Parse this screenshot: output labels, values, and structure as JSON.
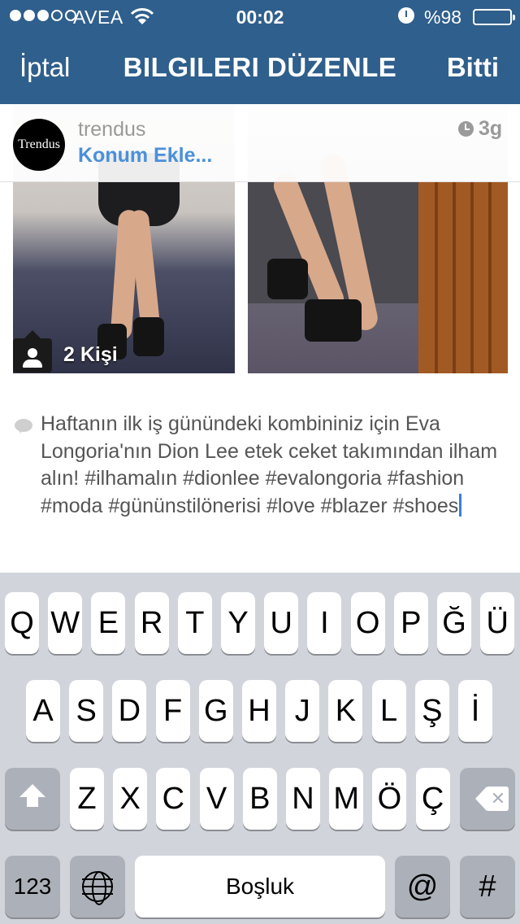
{
  "status_bar": {
    "carrier": "AVEA",
    "time": "00:02",
    "battery_percent": "%98",
    "battery_level": 0.98,
    "signal_bars_filled": 3,
    "signal_bars_total": 5
  },
  "nav": {
    "cancel_label": "İptal",
    "title": "BILGILERI DÜZENLE",
    "done_label": "Bitti"
  },
  "post": {
    "avatar_text": "Trendus",
    "username": "trendus",
    "location_label": "Konum Ekle...",
    "time_ago": "3g",
    "tagged_people": "2 Kişi",
    "caption": "Haftanın ilk iş günündeki kombininiz için Eva Longoria'nın Dion Lee etek ceket takımından ilham alın! #ilhamalın #dionlee #evalongoria #fashion #moda #gününstilönerisi #love #blazer #shoes"
  },
  "keyboard": {
    "row1": [
      "Q",
      "W",
      "E",
      "R",
      "T",
      "Y",
      "U",
      "I",
      "O",
      "P",
      "Ğ",
      "Ü"
    ],
    "row2": [
      "A",
      "S",
      "D",
      "F",
      "G",
      "H",
      "J",
      "K",
      "L",
      "Ş",
      "İ"
    ],
    "row3": [
      "Z",
      "X",
      "C",
      "V",
      "B",
      "N",
      "M",
      "Ö",
      "Ç"
    ],
    "numbers_label": "123",
    "space_label": "Boşluk",
    "at_label": "@",
    "hash_label": "#"
  },
  "icons": {
    "wifi": "wifi-icon",
    "alarm": "alarm-icon",
    "clock": "clock-icon",
    "person": "person-icon",
    "comment": "comment-bubble-icon",
    "shift": "shift-icon",
    "backspace": "backspace-icon",
    "globe": "globe-icon"
  },
  "colors": {
    "nav_background": "#2f5f8c",
    "link_blue": "#4a90d9",
    "keyboard_background": "#d1d5db"
  }
}
